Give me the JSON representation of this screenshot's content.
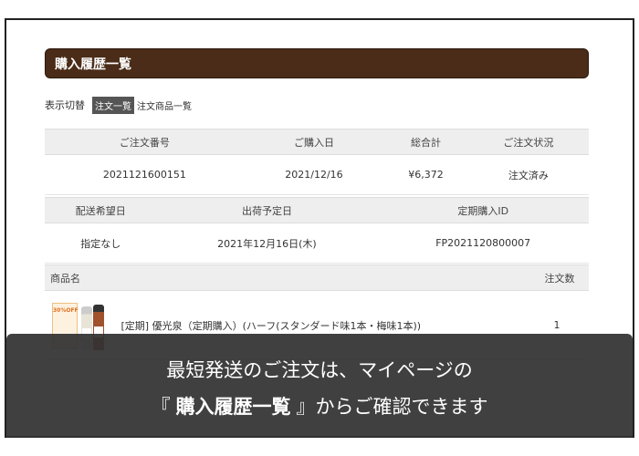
{
  "header": {
    "title": "購入履歴一覧"
  },
  "toggle": {
    "label": "表示切替",
    "options": [
      "注文一覧",
      "注文商品一覧"
    ],
    "active_index": 0
  },
  "order_table": {
    "headers": [
      "ご注文番号",
      "ご購入日",
      "総合計",
      "ご注文状況"
    ],
    "row": [
      "2021121600151",
      "2021/12/16",
      "¥6,372",
      "注文済み"
    ]
  },
  "shipping_table": {
    "headers": [
      "配送希望日",
      "出荷予定日",
      "定期購入ID"
    ],
    "row": [
      "指定なし",
      "2021年12月16日(木)",
      "FP2021120800007"
    ]
  },
  "items_table": {
    "headers": [
      "商品名",
      "注文数"
    ],
    "items": [
      {
        "badge": "30%OFF",
        "name": "[定期] 優光泉（定期購入）(ハーフ(スタンダード味1本・梅味1本))",
        "qty": "1"
      }
    ]
  },
  "banner": {
    "line1": "最短発送のご注文は、マイページの",
    "line2_prefix": "『",
    "line2_bold": "購入履歴一覧",
    "line2_suffix": "』からご確認できます"
  }
}
